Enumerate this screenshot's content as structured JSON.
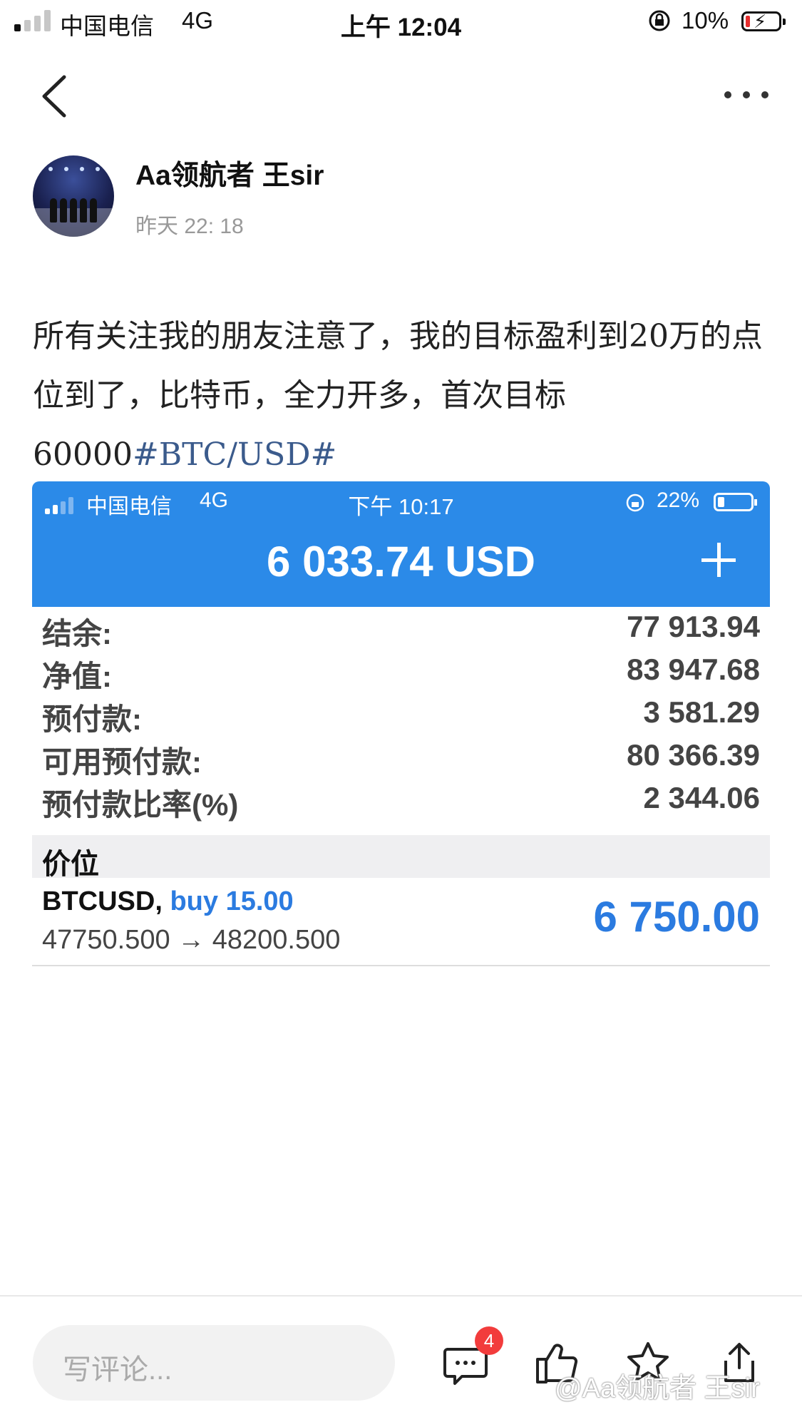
{
  "status_bar": {
    "carrier": "中国电信",
    "network": "4G",
    "time": "上午 12:04",
    "battery": "10%"
  },
  "nav": {
    "back_icon": "chevron-left-icon",
    "more_icon": "more-dots-icon"
  },
  "author": {
    "name": "Aa领航者 王sir",
    "time": "昨天 22: 18"
  },
  "post": {
    "text": "所有关注我的朋友注意了，我的目标盈利到20万的点位到了，比特币，全力开多，首次目标60000",
    "hashtag": "#BTC/USD#"
  },
  "screenshot": {
    "status_bar": {
      "carrier": "中国电信",
      "network": "4G",
      "time": "下午 10:17",
      "battery": "22%"
    },
    "balance": "6 033.74 USD",
    "rows": [
      {
        "label": "结余:",
        "value": "77 913.94"
      },
      {
        "label": "净值:",
        "value": "83 947.68"
      },
      {
        "label": "预付款:",
        "value": "3 581.29"
      },
      {
        "label": "可用预付款:",
        "value": "80 366.39"
      },
      {
        "label": "预付款比率(%)",
        "value": "2 344.06"
      }
    ],
    "section_title": "价位",
    "position": {
      "symbol": "BTCUSD,",
      "side": "buy 15.00",
      "prices": "47750.500 → 48200.500",
      "profit": "6 750.00"
    }
  },
  "bottom_bar": {
    "comment_placeholder": "写评论...",
    "comment_count": "4",
    "watermark": "@Aa领航者 王sir"
  },
  "colors": {
    "accent_blue": "#2b8ae8",
    "badge_red": "#f23c3c",
    "hashtag": "#3b5b8c"
  }
}
